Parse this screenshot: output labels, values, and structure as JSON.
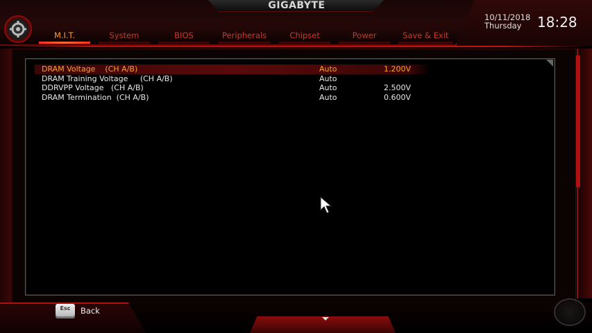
{
  "header": {
    "brand": "GIGABYTE",
    "date": "10/11/2018",
    "weekday": "Thursday",
    "time": "18:28"
  },
  "tabs": [
    {
      "label": "M.I.T.",
      "active": true
    },
    {
      "label": "System",
      "active": false
    },
    {
      "label": "BIOS",
      "active": false
    },
    {
      "label": "Peripherals",
      "active": false
    },
    {
      "label": "Chipset",
      "active": false
    },
    {
      "label": "Power",
      "active": false
    },
    {
      "label": "Save & Exit",
      "active": false
    }
  ],
  "settings": [
    {
      "name": "DRAM Voltage    (CH A/B)",
      "mode": "Auto",
      "value": "1.200V",
      "selected": true
    },
    {
      "name": "DRAM Training Voltage     (CH A/B)",
      "mode": "Auto",
      "value": "",
      "selected": false
    },
    {
      "name": "DDRVPP Voltage   (CH A/B)",
      "mode": "Auto",
      "value": "2.500V",
      "selected": false
    },
    {
      "name": "DRAM Termination  (CH A/B)",
      "mode": "Auto",
      "value": "0.600V",
      "selected": false
    }
  ],
  "footer": {
    "esc_key": "Esc",
    "back_label": "Back"
  },
  "colors": {
    "accent": "#c21212",
    "selected_text": "#ffa030",
    "tab_text": "#c73a2a"
  }
}
